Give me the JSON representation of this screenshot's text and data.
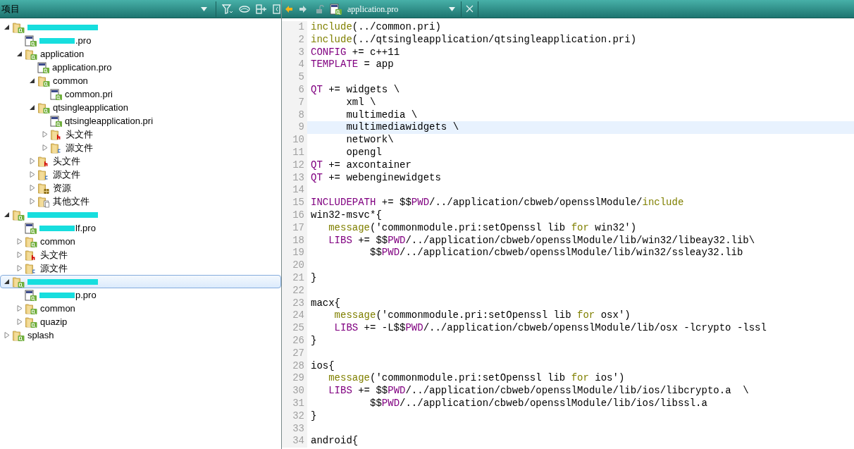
{
  "sidebar": {
    "title": "项目",
    "tree": [
      {
        "kind": "project",
        "redacted": true,
        "expanded": true,
        "selected": false,
        "children": [
          {
            "kind": "pro_file",
            "redacted": true,
            "label": ".pro",
            "selected": false
          },
          {
            "kind": "project",
            "label": "application",
            "expanded": true,
            "selected": false,
            "children": [
              {
                "kind": "pro_file",
                "label": "application.pro",
                "selected": false
              },
              {
                "kind": "project",
                "label": "common",
                "expanded": true,
                "selected": false,
                "children": [
                  {
                    "kind": "pro_file",
                    "label": "common.pri",
                    "selected": false
                  }
                ]
              },
              {
                "kind": "project",
                "label": "qtsingleapplication",
                "expanded": true,
                "selected": false,
                "children": [
                  {
                    "kind": "pro_file",
                    "label": "qtsingleapplication.pri",
                    "selected": false
                  },
                  {
                    "kind": "headers",
                    "label": "头文件",
                    "expanded": false,
                    "selected": false
                  },
                  {
                    "kind": "sources",
                    "label": "源文件",
                    "expanded": false,
                    "selected": false
                  }
                ]
              },
              {
                "kind": "headers",
                "label": "头文件",
                "expanded": false,
                "selected": false
              },
              {
                "kind": "sources",
                "label": "源文件",
                "expanded": false,
                "selected": false
              },
              {
                "kind": "resources",
                "label": "资源",
                "expanded": false,
                "selected": false
              },
              {
                "kind": "other",
                "label": "其他文件",
                "expanded": false,
                "selected": false
              }
            ]
          }
        ]
      },
      {
        "kind": "project",
        "redacted": true,
        "expanded": true,
        "selected": false,
        "children": [
          {
            "kind": "pro_file",
            "redacted": true,
            "label": "lf.pro",
            "selected": false
          },
          {
            "kind": "project",
            "label": "common",
            "expanded": false,
            "selected": false
          },
          {
            "kind": "headers",
            "label": "头文件",
            "expanded": false,
            "selected": false
          },
          {
            "kind": "sources",
            "label": "源文件",
            "expanded": false,
            "selected": false
          }
        ]
      },
      {
        "kind": "project",
        "redacted": true,
        "expanded": true,
        "selected": true,
        "children": [
          {
            "kind": "pro_file",
            "redacted": true,
            "label": "p.pro",
            "selected": false
          },
          {
            "kind": "project",
            "label": "common",
            "expanded": false,
            "selected": false
          },
          {
            "kind": "project",
            "label": "quazip",
            "expanded": false,
            "selected": false
          }
        ]
      },
      {
        "kind": "project",
        "label": "splash",
        "expanded": false,
        "selected": false
      }
    ]
  },
  "editor": {
    "file_name": "application.pro",
    "lines": [
      {
        "number": "1",
        "tokens": [
          {
            "text": "include",
            "kind": "function"
          },
          {
            "text": "(../common.pri)",
            "kind": "plain"
          }
        ]
      },
      {
        "number": "2",
        "tokens": [
          {
            "text": "include",
            "kind": "function"
          },
          {
            "text": "(../qtsingleapplication/qtsingleapplication.pri)",
            "kind": "plain"
          }
        ]
      },
      {
        "number": "3",
        "tokens": [
          {
            "text": "CONFIG",
            "kind": "variable"
          },
          {
            "text": " += c++11",
            "kind": "plain"
          }
        ]
      },
      {
        "number": "4",
        "tokens": [
          {
            "text": "TEMPLATE",
            "kind": "variable"
          },
          {
            "text": " = app",
            "kind": "plain"
          }
        ]
      },
      {
        "number": "5"
      },
      {
        "number": "6",
        "tokens": [
          {
            "text": "QT",
            "kind": "variable"
          },
          {
            "text": " += widgets \\",
            "kind": "plain"
          }
        ]
      },
      {
        "number": "7",
        "tokens": [
          {
            "text": "      xml \\",
            "kind": "plain"
          }
        ]
      },
      {
        "number": "8",
        "tokens": [
          {
            "text": "      multimedia \\",
            "kind": "plain"
          }
        ]
      },
      {
        "number": "9",
        "current": true,
        "tokens": [
          {
            "text": "      multimediawidgets \\",
            "kind": "plain"
          }
        ]
      },
      {
        "number": "10",
        "tokens": [
          {
            "text": "      network\\",
            "kind": "plain"
          }
        ]
      },
      {
        "number": "11",
        "tokens": [
          {
            "text": "      opengl",
            "kind": "plain"
          }
        ]
      },
      {
        "number": "12",
        "tokens": [
          {
            "text": "QT",
            "kind": "variable"
          },
          {
            "text": " += axcontainer",
            "kind": "plain"
          }
        ]
      },
      {
        "number": "13",
        "tokens": [
          {
            "text": "QT",
            "kind": "variable"
          },
          {
            "text": " += webenginewidgets",
            "kind": "plain"
          }
        ]
      },
      {
        "number": "14"
      },
      {
        "number": "15",
        "tokens": [
          {
            "text": "INCLUDEPATH",
            "kind": "variable"
          },
          {
            "text": " += $$",
            "kind": "plain"
          },
          {
            "text": "PWD",
            "kind": "variable"
          },
          {
            "text": "/../application/cbweb/opensslModule/",
            "kind": "plain"
          },
          {
            "text": "include",
            "kind": "function"
          }
        ]
      },
      {
        "number": "16",
        "tokens": [
          {
            "text": "win32-msvc*{",
            "kind": "plain"
          }
        ]
      },
      {
        "number": "17",
        "kind": "nested",
        "tokens": [
          {
            "text": "message",
            "kind": "function"
          },
          {
            "text": "('commonmodule.pri:setOpenssl lib ",
            "kind": "plain"
          },
          {
            "text": "for",
            "kind": "function"
          },
          {
            "text": " win32')",
            "kind": "plain"
          }
        ]
      },
      {
        "number": "18",
        "kind": "nested",
        "tokens": [
          {
            "text": "LIBS",
            "kind": "variable"
          },
          {
            "text": " += $$",
            "kind": "plain"
          },
          {
            "text": "PWD",
            "kind": "variable"
          },
          {
            "text": "/../application/cbweb/opensslModule/lib/win32/libeay32.lib\\",
            "kind": "plain"
          }
        ]
      },
      {
        "number": "19",
        "tokens": [
          {
            "text": "          $$",
            "kind": "plain"
          },
          {
            "text": "PWD",
            "kind": "variable"
          },
          {
            "text": "/../application/cbweb/opensslModule/lib/win32/ssleay32.lib",
            "kind": "plain"
          }
        ]
      },
      {
        "number": "20"
      },
      {
        "number": "21",
        "tokens": [
          {
            "text": "}",
            "kind": "plain"
          }
        ]
      },
      {
        "number": "22"
      },
      {
        "number": "23",
        "tokens": [
          {
            "text": "macx{",
            "kind": "plain"
          }
        ]
      },
      {
        "number": "24",
        "kind": "nested_wide",
        "tokens": [
          {
            "text": "message",
            "kind": "function"
          },
          {
            "text": "('commonmodule.pri:setOpenssl lib ",
            "kind": "plain"
          },
          {
            "text": "for",
            "kind": "function"
          },
          {
            "text": " osx')",
            "kind": "plain"
          }
        ]
      },
      {
        "number": "25",
        "kind": "nested_wide",
        "tokens": [
          {
            "text": "LIBS",
            "kind": "variable"
          },
          {
            "text": " += -L$$",
            "kind": "plain"
          },
          {
            "text": "PWD",
            "kind": "variable"
          },
          {
            "text": "/../application/cbweb/opensslModule/lib/osx -lcrypto -lssl",
            "kind": "plain"
          }
        ]
      },
      {
        "number": "26",
        "tokens": [
          {
            "text": "}",
            "kind": "plain"
          }
        ]
      },
      {
        "number": "27"
      },
      {
        "number": "28",
        "tokens": [
          {
            "text": "ios{",
            "kind": "plain"
          }
        ]
      },
      {
        "number": "29",
        "kind": "nested",
        "tokens": [
          {
            "text": "message",
            "kind": "function"
          },
          {
            "text": "('commonmodule.pri:setOpenssl lib ",
            "kind": "plain"
          },
          {
            "text": "for",
            "kind": "function"
          },
          {
            "text": " ios')",
            "kind": "plain"
          }
        ]
      },
      {
        "number": "30",
        "kind": "nested",
        "tokens": [
          {
            "text": "LIBS",
            "kind": "variable"
          },
          {
            "text": " += $$",
            "kind": "plain"
          },
          {
            "text": "PWD",
            "kind": "variable"
          },
          {
            "text": "/../application/cbweb/opensslModule/lib/ios/libcrypto.a  \\",
            "kind": "plain"
          }
        ]
      },
      {
        "number": "31",
        "tokens": [
          {
            "text": "          $$",
            "kind": "plain"
          },
          {
            "text": "PWD",
            "kind": "variable"
          },
          {
            "text": "/../application/cbweb/opensslModule/lib/ios/libssl.a",
            "kind": "plain"
          }
        ]
      },
      {
        "number": "32",
        "tokens": [
          {
            "text": "}",
            "kind": "plain"
          }
        ]
      },
      {
        "number": "33"
      },
      {
        "number": "34",
        "tokens": [
          {
            "text": "android{",
            "kind": "plain"
          }
        ]
      }
    ]
  }
}
